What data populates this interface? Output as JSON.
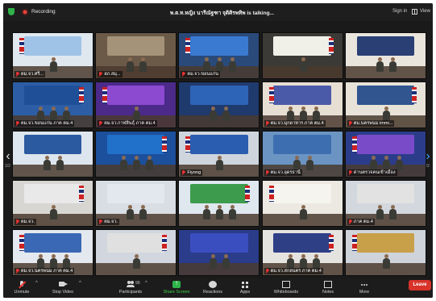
{
  "topbar": {
    "recording_label": "Recording",
    "talking_text": "พ.ต.ท.หญิง นารีณัฐฑา จุติศิรพทิพ is talking...",
    "sign_in_label": "Sign in",
    "view_label": "View"
  },
  "colors": {
    "recording_red": "#e8453c",
    "shield_green": "#2fb34a",
    "leave_red": "#d8332a",
    "active_speaker_green": "#3ed34a"
  },
  "pagination": {
    "left": "1/2",
    "right": "1/2"
  },
  "tiles": [
    {
      "label": "ตม.จว.ศรี...",
      "bg": "#dfe7ef",
      "banner": "#9fc3e6"
    },
    {
      "label": "สภ.สมุ...",
      "bg": "#6b5a48",
      "banner": "#a49378"
    },
    {
      "label": "ตม.จว.ขอนแก่น",
      "bg": "#2a4a7a",
      "banner": "#3a7ad1"
    },
    {
      "label": "",
      "bg": "#3c3a36",
      "banner": "#f0efe8"
    },
    {
      "label": "",
      "bg": "#e9e5dd",
      "banner": "#2a3f74"
    },
    {
      "label": "ตม.จว.ขอนแก่น ภาค ตม.4",
      "bg": "#2d5ea5",
      "banner": "#1f4f96"
    },
    {
      "label": "ตม.จว.กาฬสินธุ์ ภาค ตม.4",
      "bg": "#4b2a8a",
      "banner": "#8c4ad1"
    },
    {
      "label": "",
      "bg": "#1f3a6c",
      "banner": "#2d64b8"
    },
    {
      "label": "ตม.จว.มุกดาหาร ภาค ตม.4",
      "bg": "#e7dfd3",
      "banner": "#4b5aa8"
    },
    {
      "label": "ตม.นครพนม immi...",
      "bg": "#e8e3d8",
      "banner": "#30558f"
    },
    {
      "label": "",
      "bg": "#dde6ee",
      "banner": "#2c5aa0"
    },
    {
      "label": "",
      "bg": "#1c4f9c",
      "banner": "#2170c9"
    },
    {
      "label": "Fiyong",
      "bg": "#cfd5dd",
      "banner": "#2a5db0"
    },
    {
      "label": "ตม.จว.อุดรธานี",
      "bg": "#6b94c3",
      "banner": "#3d6fb0"
    },
    {
      "label": "ด่านตรวจคนเข้าเมือง",
      "bg": "#2b3d8a",
      "banner": "#7a4bc9"
    },
    {
      "label": "ตม.จว.",
      "bg": "#d8d6d2",
      "banner": "#e9e9e9"
    },
    {
      "label": "ตม.จว.",
      "bg": "#d9dde4",
      "banner": "#e3e7ee"
    },
    {
      "label": "",
      "bg": "#dfe7ef",
      "banner": "#3c9b4c"
    },
    {
      "label": "",
      "bg": "#ece9e2",
      "banner": "#f5f4ef"
    },
    {
      "label": "ภาค ตม.4",
      "bg": "#d3d7de",
      "banner": "#e2e2e2"
    },
    {
      "label": "ตม.จว.นครพนม ภาค ตม.4",
      "bg": "#e4e8ef",
      "banner": "#3b68b4"
    },
    {
      "label": "",
      "bg": "#d2d6de",
      "banner": "#e0e0e0"
    },
    {
      "label": "",
      "bg": "#2a3c8a",
      "banner": "#3b4ec0"
    },
    {
      "label": "ตม.จว.สกลนคร ภาค ตม.4",
      "bg": "#e5e3df",
      "banner": "#2e3f86"
    },
    {
      "label": "",
      "bg": "#cfd4da",
      "banner": "#c9a04a"
    }
  ],
  "toolbar": {
    "unmute": "Unmute",
    "stop_video": "Stop Video",
    "participants": "Participants",
    "participants_count": "99",
    "share_screen": "Share Screen",
    "reactions": "Reactions",
    "apps": "Apps",
    "whiteboards": "Whiteboards",
    "notes": "Notes",
    "more": "More",
    "leave": "Leave"
  }
}
